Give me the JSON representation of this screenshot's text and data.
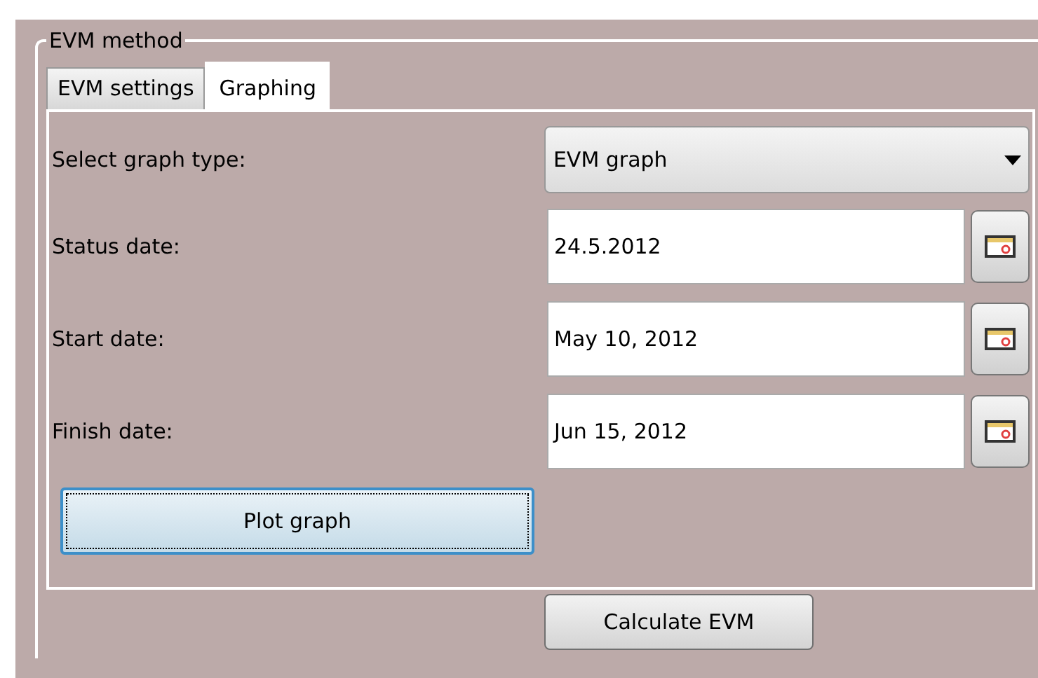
{
  "group": {
    "title": "EVM method"
  },
  "tabs": [
    {
      "label": "EVM settings",
      "selected": false
    },
    {
      "label": "Graphing",
      "selected": true
    }
  ],
  "rows": [
    {
      "kind": "combo",
      "label": "Select graph type:",
      "value": "EVM graph"
    },
    {
      "kind": "date",
      "label": "Status date:",
      "value": "24.5.2012"
    },
    {
      "kind": "date",
      "label": "Start date:",
      "value": "May 10, 2012"
    },
    {
      "kind": "date",
      "label": "Finish date:",
      "value": "Jun 15, 2012"
    }
  ],
  "plot_button": {
    "label": "Plot graph",
    "focused": true
  },
  "calculate_button": {
    "label": "Calculate EVM"
  }
}
